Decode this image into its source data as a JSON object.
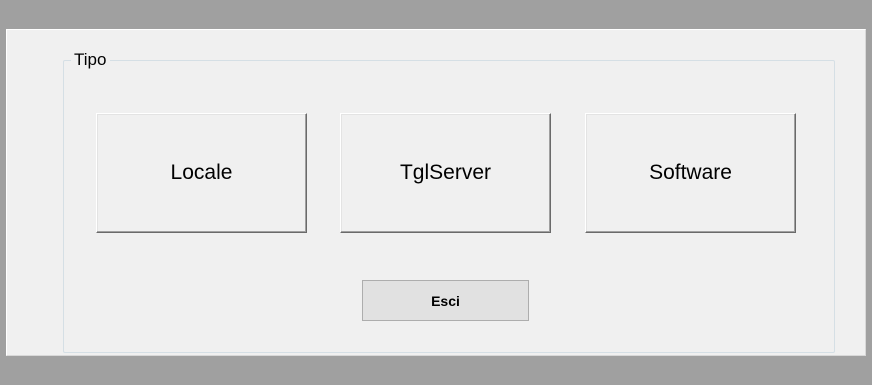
{
  "group": {
    "label": "Tipo"
  },
  "buttons": [
    {
      "label": "Locale"
    },
    {
      "label": "TglServer"
    },
    {
      "label": "Software"
    }
  ],
  "exit": {
    "label": "Esci"
  }
}
